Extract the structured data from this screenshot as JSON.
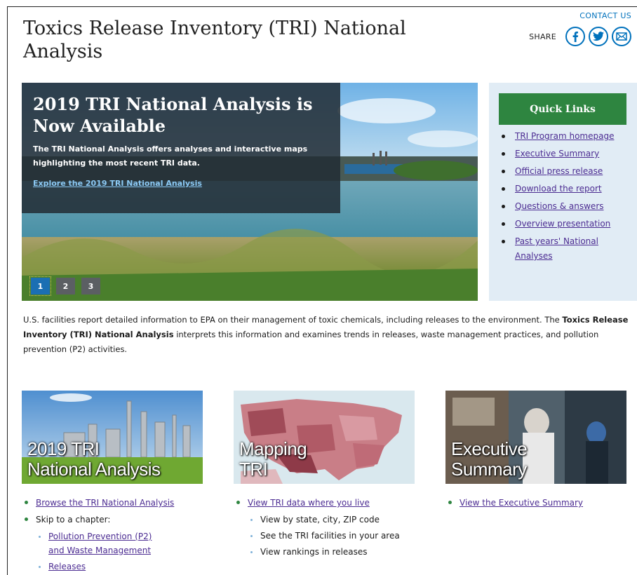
{
  "header": {
    "title": "Toxics Release Inventory (TRI) National Analysis",
    "contact": "CONTACT US",
    "share_label": "SHARE",
    "share_icons": [
      "facebook-icon",
      "twitter-icon",
      "email-icon"
    ]
  },
  "hero": {
    "heading": "2019 TRI National Analysis is Now Available",
    "text": "The TRI National Analysis offers analyses and interactive maps highlighting the most recent TRI data.",
    "link": "Explore the 2019 TRI National Analysis",
    "pages": [
      "1",
      "2",
      "3"
    ],
    "active_page": "1"
  },
  "quick_links": {
    "heading": "Quick Links",
    "items": [
      "TRI Program homepage",
      "Executive Summary",
      "Official press release",
      "Download the report",
      "Questions & answers",
      "Overview presentation",
      "Past years' National Analyses"
    ]
  },
  "intro": {
    "part1": "U.S. facilities report detailed information to EPA on their management of toxic chemicals, including releases to the environment. The ",
    "bold": "Toxics Release Inventory (TRI) National Analysis",
    "part2": " interprets this information and examines trends in releases, waste management practices, and pollution prevention (P2) activities."
  },
  "cards": {
    "analysis": {
      "title_line1": "2019 TRI",
      "title_line2": "National Analysis",
      "link": "Browse the TRI National Analysis",
      "skip_label": "Skip to a chapter:",
      "chapters": [
        "Pollution Prevention (P2) and Waste Management",
        "Releases"
      ]
    },
    "mapping": {
      "title_line1": "Mapping",
      "title_line2": "TRI",
      "link": "View TRI data where you live",
      "subitems": [
        "View by state, city, ZIP code",
        "See the TRI facilities in your area",
        "View rankings in releases"
      ]
    },
    "executive": {
      "title_line1": "Executive",
      "title_line2": "Summary",
      "link": "View the Executive Summary"
    }
  },
  "colors": {
    "accent_green": "#2e8540",
    "link_purple": "#4c2c92",
    "share_blue": "#0071bc",
    "quicklinks_bg": "#e1ecf5"
  }
}
